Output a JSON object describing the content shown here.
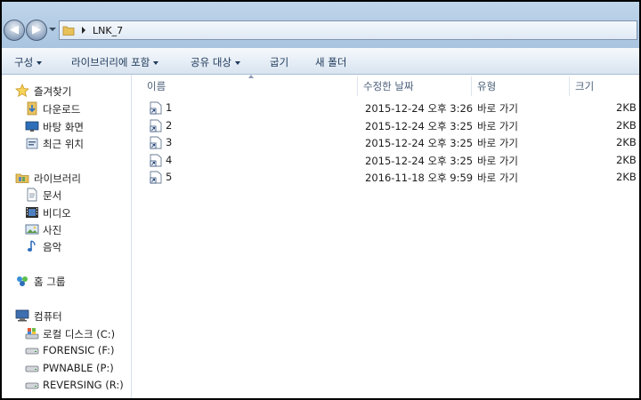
{
  "address": {
    "path": "LNK_7"
  },
  "commands": [
    {
      "label": "구성",
      "dropdown": true
    },
    {
      "label": "라이브러리에 포함",
      "dropdown": true
    },
    {
      "label": "공유 대상",
      "dropdown": true
    },
    {
      "label": "굽기",
      "dropdown": false
    },
    {
      "label": "새 폴더",
      "dropdown": false
    }
  ],
  "nav": {
    "favorites": {
      "label": "즐겨찾기",
      "items": [
        "다운로드",
        "바탕 화면",
        "최근 위치"
      ]
    },
    "libraries": {
      "label": "라이브러리",
      "items": [
        "문서",
        "비디오",
        "사진",
        "음악"
      ]
    },
    "homegroup": {
      "label": "홈 그룹"
    },
    "computer": {
      "label": "컴퓨터",
      "items": [
        "로컬 디스크 (C:)",
        "FORENSIC (F:)",
        "PWNABLE (P:)",
        "REVERSING (R:)"
      ]
    }
  },
  "columns": {
    "name": "이름",
    "modified": "수정한 날짜",
    "type": "유형",
    "size": "크기"
  },
  "files": [
    {
      "name": "1",
      "modified": "2015-12-24 오후 3:26",
      "type": "바로 가기",
      "size": "2KB"
    },
    {
      "name": "2",
      "modified": "2015-12-24 오후 3:25",
      "type": "바로 가기",
      "size": "2KB"
    },
    {
      "name": "3",
      "modified": "2015-12-24 오후 3:25",
      "type": "바로 가기",
      "size": "2KB"
    },
    {
      "name": "4",
      "modified": "2015-12-24 오후 3:25",
      "type": "바로 가기",
      "size": "2KB"
    },
    {
      "name": "5",
      "modified": "2016-11-18 오후 9:59",
      "type": "바로 가기",
      "size": "2KB"
    }
  ]
}
